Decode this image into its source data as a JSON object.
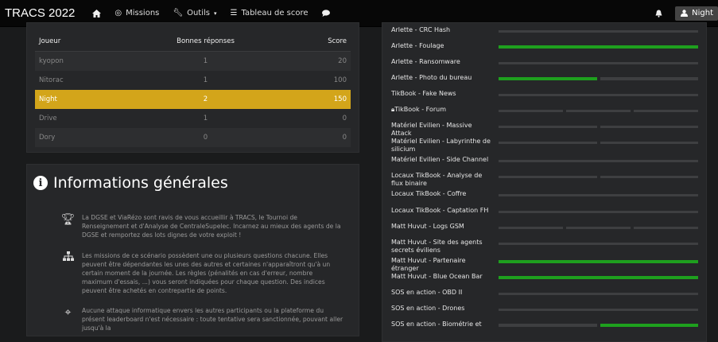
{
  "nav": {
    "brand": "TRACS 2022",
    "home_icon": "home-icon",
    "missions": "Missions",
    "outils": "Outils",
    "scoreboard": "Tableau de score",
    "chat_icon": "chat-icon",
    "bell_icon": "bell-icon",
    "user": "Night"
  },
  "scores": {
    "headers": [
      "Joueur",
      "Bonnes réponses",
      "Score"
    ],
    "rows": [
      {
        "player": "kyopon",
        "correct": "1",
        "score": "20"
      },
      {
        "player": "Nitorac",
        "correct": "1",
        "score": "100"
      },
      {
        "player": "Night",
        "correct": "2",
        "score": "150"
      },
      {
        "player": "Drive",
        "correct": "1",
        "score": "0"
      },
      {
        "player": "Dory",
        "correct": "0",
        "score": "0"
      }
    ],
    "highlight_color": "#d3a51a"
  },
  "info": {
    "title": "Informations générales",
    "items": [
      {
        "icon": "trophy-icon",
        "text": "La DGSE et ViaRézo sont ravis de vous accueillir à TRACS, le Tournoi de Renseignement et d'Analyse de CentraleSupelec. Incarnez au mieux des agents de la DGSE et remportez des lots dignes de votre exploit !"
      },
      {
        "icon": "sitemap-icon",
        "text": "Les missions de ce scénario possèdent une ou plusieurs questions chacune. Elles peuvent être dépendantes les unes des autres et certaines n'apparaîtront qu'à un certain moment de la journée. Les règles (pénalités en cas d'erreur, nombre maximum d'essais, ...) vous seront indiquées pour chaque question. Des indices peuvent être achetés en contrepartie de points."
      },
      {
        "icon": "crosshairs-icon",
        "text": "Aucune attaque informatique envers les autres participants ou la plateforme du présent leaderboard n'est nécessaire : toute tentative sera sanctionnée, pouvant aller jusqu'à la"
      }
    ]
  },
  "challenges": [
    {
      "label": "Arlette - CRC Hash",
      "locked": false
    },
    {
      "label": "Arlette - Foulage",
      "locked": false
    },
    {
      "label": "Arlette - Ransomware",
      "locked": false
    },
    {
      "label": "Arlette - Photo du bureau",
      "locked": false
    },
    {
      "label": "TikBook - Fake News",
      "locked": false
    },
    {
      "label": "TikBook - Forum",
      "locked": true
    },
    {
      "label": "Matériel Evilien - Massive Attack",
      "locked": false
    },
    {
      "label": "Matériel Evilien - Labyrinthe de silicium",
      "locked": false
    },
    {
      "label": "Matériel Evilien - Side Channel",
      "locked": false
    },
    {
      "label": "Locaux TikBook - Analyse de flux binaire",
      "locked": false
    },
    {
      "label": "Locaux TikBook - Coffre",
      "locked": false
    },
    {
      "label": "Locaux TikBook - Captation FH",
      "locked": false
    },
    {
      "label": "Matt Huvut - Logs GSM",
      "locked": false
    },
    {
      "label": "Matt Huvut - Site des agents secrets éviliens",
      "locked": false
    },
    {
      "label": "Matt Huvut - Partenaire étranger",
      "locked": false
    },
    {
      "label": "Matt Huvut - Blue Ocean Bar",
      "locked": false
    },
    {
      "label": "SOS en action - OBD II",
      "locked": false
    },
    {
      "label": "SOS en action - Drones",
      "locked": false
    },
    {
      "label": "SOS en action - Biométrie et",
      "locked": false
    }
  ],
  "colors": {
    "progress_done": "#1ea01e",
    "progress_empty": "#3e3f41"
  }
}
